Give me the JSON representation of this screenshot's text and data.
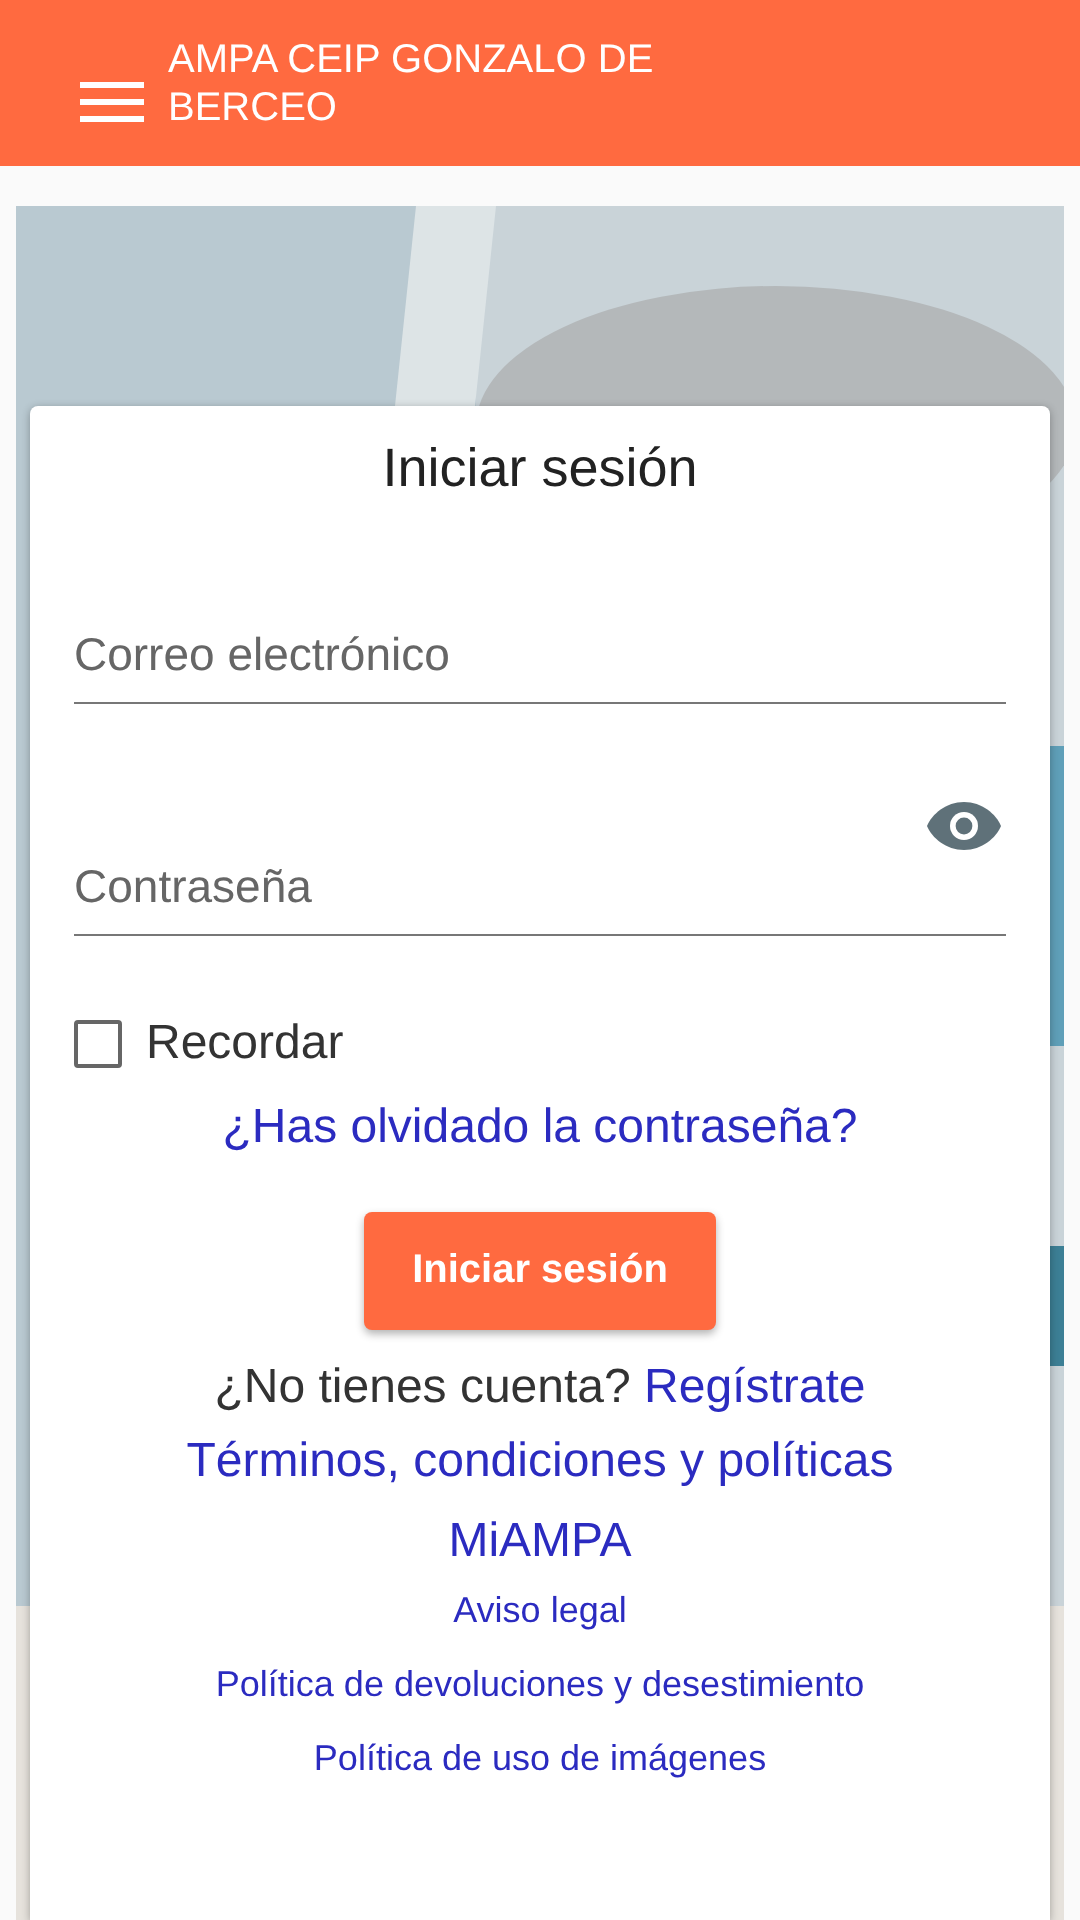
{
  "app_bar": {
    "title": "AMPA CEIP GONZALO DE BERCEO"
  },
  "login": {
    "title": "Iniciar sesión",
    "email": {
      "placeholder": "Correo electrónico"
    },
    "password": {
      "placeholder": "Contraseña"
    },
    "remember": {
      "label": "Recordar",
      "checked": false
    },
    "forgot_link": "¿Has olvidado la contraseña?",
    "submit": "Iniciar sesión",
    "signup_prompt": "¿No tienes cuenta?",
    "signup_link": "Regístrate",
    "terms_link": "Términos, condiciones y políticas MiAMPA",
    "links": [
      "Aviso legal",
      "Política de devoluciones y desestimiento",
      "Política de uso de imágenes"
    ]
  }
}
